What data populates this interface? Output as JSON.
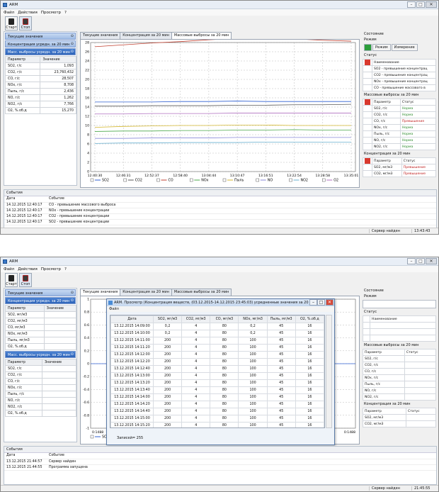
{
  "window1": {
    "title": "ARM",
    "menu": [
      "Файл",
      "Действия",
      "Просмотр",
      "?"
    ],
    "toolbar": {
      "start_label": "Старт",
      "stop_label": "Стоп"
    },
    "left": {
      "sections": [
        "Текущие значения",
        "Концентрация усредн. за 20 мин",
        "Масс. выбросы усредн. за 20 мин"
      ],
      "table_headers": [
        "Параметр",
        "Значение"
      ],
      "rows": [
        {
          "p": "SO2, г/с",
          "v": "1,093"
        },
        {
          "p": "CO2, г/с",
          "v": "23,760,432"
        },
        {
          "p": "CO, г/с",
          "v": "28,507"
        },
        {
          "p": "NOx, г/с",
          "v": "8,708"
        },
        {
          "p": "Пыль, г/с",
          "v": "2,436"
        },
        {
          "p": "NO, г/с",
          "v": "1,262"
        },
        {
          "p": "NO2, г/с",
          "v": "7,766"
        },
        {
          "p": "O2, %.об.д",
          "v": "15,270"
        }
      ]
    },
    "tabs": [
      "Текущие значения",
      "Концентрация за 20 мин",
      "Массовые выбросы за 20 мин"
    ],
    "legend": [
      "SO2",
      "CO2",
      "CO",
      "NOx",
      "Пыль",
      "NO",
      "NO2",
      "O2"
    ],
    "right": {
      "state_title": "Состояние",
      "mode_title": "Режим",
      "mode_tabs": [
        "Режим",
        "Измерение"
      ],
      "status_title": "Статус",
      "status_header": "Наименование",
      "status_rows": [
        "SO2 - превышение концентрац",
        "CO2 - превышение концентрац",
        "NOx - превышение концентрац",
        "CO - превышение массового в"
      ],
      "mass_title": "Массовые выбросы за 20 мин",
      "mass_headers": [
        "Параметр",
        "Статус"
      ],
      "mass_rows": [
        {
          "p": "SO2, г/с",
          "s": "Норма",
          "bad": false
        },
        {
          "p": "CO2, г/с",
          "s": "Норма",
          "bad": false
        },
        {
          "p": "CO, г/с",
          "s": "Превышение",
          "bad": true
        },
        {
          "p": "NOx, г/с",
          "s": "Норма",
          "bad": false
        },
        {
          "p": "Пыль, г/с",
          "s": "Норма",
          "bad": false
        },
        {
          "p": "NO, г/с",
          "s": "Норма",
          "bad": false
        },
        {
          "p": "NO2, г/с",
          "s": "Норма",
          "bad": false
        }
      ],
      "conc_title": "Концентрация за 20 мин",
      "conc_headers": [
        "Параметр",
        "Статус"
      ],
      "conc_rows": [
        {
          "p": "SO2, мг/м3",
          "s": "Превышение"
        },
        {
          "p": "CO2, мг/м3",
          "s": "Превышение"
        }
      ]
    },
    "events": {
      "title": "События",
      "headers": [
        "Дата",
        "Событие"
      ],
      "rows": [
        {
          "d": "14.12.2015 12:40:17",
          "e": "CO - превышение массового выброса"
        },
        {
          "d": "14.12.2015 12:40:17",
          "e": "NOx - превышение концентрации"
        },
        {
          "d": "14.12.2015 12:40:17",
          "e": "CO2 - превышение концентрации"
        },
        {
          "d": "14.12.2015 12:40:17",
          "e": "SO2 - превышение концентрации"
        }
      ]
    },
    "statusbar": {
      "server": "Сервер найден",
      "time": "13:43:43"
    }
  },
  "window2": {
    "title": "ARM",
    "menu": [
      "Файл",
      "Действия",
      "Просмотр",
      "?"
    ],
    "toolbar": {
      "start_label": "Старт",
      "stop_label": "Стоп"
    },
    "left": {
      "sections_a": [
        "Текущие значения",
        "Концентрация усредн. за 20 мин"
      ],
      "headers": [
        "Параметр",
        "Значение"
      ],
      "rows_a": [
        "SO2, мг/м3",
        "CO2, мг/м3",
        "CO, мг/м3",
        "NOx, мг/м3",
        "Пыль, мг/м3",
        "O2, %.об.д"
      ],
      "section_b": "Масс. выбросы усредн. за 20 мин",
      "rows_b": [
        "SO2, г/с",
        "CO2, г/с",
        "CO, г/с",
        "NOx, г/с",
        "Пыль, г/с",
        "NO, г/с",
        "NO2, г/с",
        "O2, %.об.д"
      ]
    },
    "tabs": [
      "Текущие значения",
      "Концентрация за 20 мин",
      "Массовые выбросы за 20 мин"
    ],
    "legend": [
      "SO2"
    ],
    "right": {
      "state_title": "Состояние",
      "mode_title": "Режим",
      "status_title": "Статус",
      "status_header": "Наименование",
      "mass_title": "Массовые выбросы за 20 мин",
      "mass_headers": [
        "Параметр",
        "Статус"
      ],
      "mass_rows": [
        "SO2, г/с",
        "CO2, г/с",
        "CO, г/с",
        "NOx, г/с",
        "Пыль, г/с",
        "NO, г/с",
        "NO2, г/с"
      ],
      "conc_title": "Концентрация за 20 мин",
      "conc_headers": [
        "Параметр",
        "Статус"
      ],
      "conc_rows": [
        "SO2, мг/м3",
        "CO2, мг/м3"
      ]
    },
    "dialog": {
      "title": "ARM. Просмотр (Концентрация веществ, (03.12.2015-14.12.2015 23:45:03) усредненные значения за 20 ...",
      "menu": "Файл",
      "headers": [
        "Дата",
        "SO2, мг/м3",
        "CO2, мг/м3",
        "CO, мг/м3",
        "NOx, мг/м3",
        "Пыль, мг/м3",
        "O2, %.об.д"
      ],
      "rows": [
        [
          "13.12.2015 14:09:00",
          "0,2",
          "4",
          "80",
          "0,2",
          "45",
          "16"
        ],
        [
          "13.12.2015 14:10:00",
          "0,2",
          "4",
          "80",
          "0,2",
          "45",
          "16"
        ],
        [
          "13.12.2015 14:11:00",
          "200",
          "4",
          "80",
          "100",
          "45",
          "16"
        ],
        [
          "13.12.2015 14:11:20",
          "200",
          "4",
          "80",
          "100",
          "45",
          "16"
        ],
        [
          "13.12.2015 14:12:00",
          "200",
          "4",
          "80",
          "100",
          "45",
          "16"
        ],
        [
          "13.12.2015 14:12:20",
          "200",
          "4",
          "80",
          "100",
          "45",
          "16"
        ],
        [
          "13.12.2015 14:12:40",
          "200",
          "4",
          "80",
          "100",
          "45",
          "16"
        ],
        [
          "13.12.2015 14:13:00",
          "200",
          "4",
          "80",
          "100",
          "45",
          "16"
        ],
        [
          "13.12.2015 14:13:20",
          "200",
          "4",
          "80",
          "100",
          "45",
          "16"
        ],
        [
          "13.12.2015 14:13:40",
          "200",
          "4",
          "80",
          "100",
          "45",
          "16"
        ],
        [
          "13.12.2015 14:14:00",
          "200",
          "4",
          "80",
          "100",
          "45",
          "16"
        ],
        [
          "13.12.2015 14:14:20",
          "200",
          "4",
          "80",
          "100",
          "45",
          "16"
        ],
        [
          "13.12.2015 14:14:40",
          "200",
          "4",
          "80",
          "100",
          "45",
          "16"
        ],
        [
          "13.12.2015 14:15:00",
          "200",
          "4",
          "80",
          "100",
          "45",
          "16"
        ],
        [
          "13.12.2015 14:15:20",
          "200",
          "4",
          "80",
          "100",
          "45",
          "16"
        ]
      ],
      "count": "Записей= 255"
    },
    "events": {
      "title": "События",
      "headers": [
        "Дата",
        "Событие"
      ],
      "rows": [
        {
          "d": "13.12.2015 21:44:57",
          "e": "Сервер найден"
        },
        {
          "d": "13.12.2015 21:44:55",
          "e": "Программа запущена"
        }
      ]
    },
    "statusbar": {
      "server": "Сервер найден",
      "time": "21:45:55"
    }
  },
  "chart_data": [
    {
      "type": "line",
      "x": [
        "12:40:30",
        "12:46:31",
        "12:52:37",
        "12:58:40",
        "13:04:44",
        "13:10:47",
        "13:16:51",
        "13:22:54",
        "13:28:58",
        "13:35:01"
      ],
      "ylim": [
        0,
        28
      ],
      "grid": true,
      "legend_placement": "bottom",
      "series": [
        {
          "name": "SO2",
          "color": "#2f5fd0",
          "values": [
            15.1,
            15.1,
            15.1,
            15.2,
            15.2,
            15.3,
            15.2,
            15.2,
            15.2,
            15.2
          ]
        },
        {
          "name": "CO2",
          "color": "#5a5a5a",
          "values": [
            14.2,
            14.2,
            14.3,
            14.3,
            14.3,
            14.4,
            14.4,
            14.5,
            14.5,
            14.6
          ]
        },
        {
          "name": "CO",
          "color": "#c04030",
          "values": [
            27.1,
            27.5,
            27.9,
            28.2,
            28.6,
            28.9,
            29.0,
            28.8,
            28.5,
            28.3
          ]
        },
        {
          "name": "NOx",
          "color": "#4aa84a",
          "values": [
            8.7,
            8.8,
            8.8,
            8.9,
            8.9,
            9.0,
            9.0,
            9.1,
            9.0,
            9.0
          ]
        },
        {
          "name": "Пыль",
          "color": "#d4b830",
          "values": [
            9.6,
            9.8,
            9.9,
            10.0,
            10.0,
            10.1,
            10.1,
            10.0,
            10.0,
            10.0
          ]
        },
        {
          "name": "NO",
          "color": "#8a8ad8",
          "values": [
            7.2,
            7.2,
            7.3,
            7.3,
            7.3,
            7.4,
            7.4,
            7.4,
            7.4,
            7.4
          ]
        },
        {
          "name": "NO2",
          "color": "#6ab0d0",
          "values": [
            6.1,
            6.2,
            6.2,
            6.3,
            6.3,
            6.3,
            6.4,
            6.4,
            6.4,
            6.4
          ]
        },
        {
          "name": "O2",
          "color": "#b070c0",
          "values": [
            12.5,
            12.5,
            12.6,
            12.6,
            12.6,
            12.7,
            12.7,
            12.7,
            12.7,
            12.7
          ]
        }
      ]
    },
    {
      "type": "line",
      "x": [
        "0:1488",
        "0:1488"
      ],
      "ylim": [
        -1,
        1
      ],
      "grid": true,
      "series": [
        {
          "name": "SO2",
          "color": "#2f5fd0",
          "values": [
            0,
            0
          ]
        }
      ]
    }
  ]
}
